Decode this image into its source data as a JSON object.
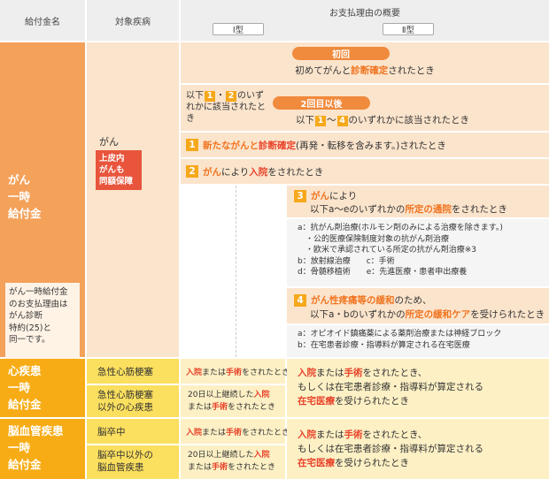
{
  "header": {
    "col_benefit": "給付金名",
    "col_disease": "対象疾病",
    "col_reason": "お支払理由の概要",
    "type1": "Ⅰ型",
    "type2": "Ⅱ型"
  },
  "cancer": {
    "name": "がん\n一時\n給付金",
    "disease": "がん",
    "tag": "上皮内\nがんも\n同額保障",
    "note": "がん一時給付金\nのお支払理由は\nがん診断\n特約(25)と\n同一です。",
    "first_pill": "初回",
    "first_text_a": "初めてがんと",
    "first_text_b": "診断確定",
    "first_text_c": "されたとき",
    "type1_text_a": "以下",
    "type1_text_b": "のいずれかに該当されたとき",
    "second_pill": "2回目以後",
    "second_text_a": "以下",
    "second_text_b": "〜",
    "second_text_c": "のいずれかに該当されたとき",
    "n1": "1",
    "n2": "2",
    "n3": "3",
    "n4": "4",
    "r1_a": "新たながんと",
    "r1_b": "診断確定",
    "r1_c": "(再発・転移を含みます。)されたとき",
    "r2_a": "がん",
    "r2_b": "により",
    "r2_c": "入院",
    "r2_d": "をされたとき",
    "r3_a": "がん",
    "r3_b": "により",
    "r3_c": "以下a〜eのいずれかの",
    "r3_d": "所定の通院",
    "r3_e": "をされたとき",
    "r3_list": [
      "a：抗がん剤治療(ホルモン剤のみによる治療を除きます。)",
      "　・公的医療保険制度対象の抗がん剤治療",
      "　・欧米で承認されている所定の抗がん剤治療※3",
      "b：放射線治療　　c：手術",
      "d：骨髄移植術　　e：先進医療・患者申出療養"
    ],
    "r4_a": "がん性疼痛等の緩和",
    "r4_b": "のため、",
    "r4_c": "以下a・bのいずれかの",
    "r4_d": "所定の緩和ケア",
    "r4_e": "を受けられたとき",
    "r4_list": [
      "a：オピオイド鎮痛薬による薬剤治療または神経ブロック",
      "b：在宅患者診療・指導料が算定される在宅医療"
    ]
  },
  "heart": {
    "name": "心疾患\n一時\n給付金",
    "d1": "急性心筋梗塞",
    "d2": "急性心筋梗塞\n以外の心疾患",
    "t1_a": "入院",
    "t1_b": "または",
    "t1_c": "手術",
    "t1_d": "をされたとき",
    "t2_a": "20日以上継続した",
    "t2_b": "入院",
    "t2_c": "または",
    "t2_d": "手術",
    "t2_e": "をされたとき",
    "type2_a": "入院",
    "type2_b": "または",
    "type2_c": "手術",
    "type2_d": "をされたとき、",
    "type2_e": "もしくは在宅患者診療・指導料が算定される",
    "type2_f": "在宅医療",
    "type2_g": "を受けられたとき"
  },
  "brain": {
    "name": "脳血管疾患\n一時\n給付金",
    "d1": "脳卒中",
    "d2": "脳卒中以外の\n脳血管疾患",
    "t1_a": "入院",
    "t1_b": "または",
    "t1_c": "手術",
    "t1_d": "をされたとき",
    "t2_a": "20日以上継続した",
    "t2_b": "入院",
    "t2_c": "または",
    "t2_d": "手術",
    "t2_e": "をされたとき",
    "type2_a": "入院",
    "type2_b": "または",
    "type2_c": "手術",
    "type2_d": "をされたとき、",
    "type2_e": "もしくは在宅患者診療・指導料が算定される",
    "type2_f": "在宅医療",
    "type2_g": "を受けられたとき"
  },
  "colors": {
    "cancer_main": "#f4a15a",
    "cancer_light": "#fbe4cc",
    "pill": "#f08a3c",
    "heart_brain_main": "#f7ac15",
    "heart_brain_light": "#fbdf5e",
    "accent_red": "#e8432a"
  }
}
